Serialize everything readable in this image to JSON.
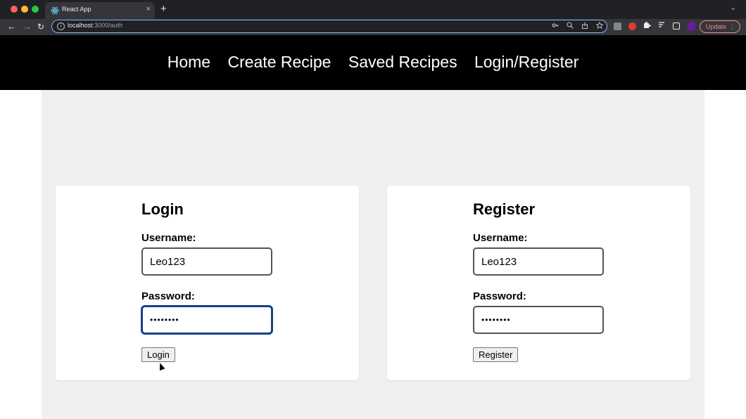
{
  "browser": {
    "tab_title": "React App",
    "tab_close": "×",
    "new_tab": "+",
    "tab_menu": "⌄",
    "url_host": "localhost",
    "url_path": ":3000/auth",
    "update_label": "Update",
    "update_menu": "⋮",
    "back": "←",
    "forward": "→",
    "reload": "↻",
    "info": "i"
  },
  "nav": {
    "links": [
      "Home",
      "Create Recipe",
      "Saved Recipes",
      "Login/Register"
    ]
  },
  "login": {
    "title": "Login",
    "username_label": "Username:",
    "username_value": "Leo123",
    "password_label": "Password:",
    "password_mask": "••••••••",
    "button_label": "Login"
  },
  "register": {
    "title": "Register",
    "username_label": "Username:",
    "username_value": "Leo123",
    "password_label": "Password:",
    "password_mask": "••••••••",
    "button_label": "Register"
  },
  "icons": {
    "favicon": "react-icon",
    "key": "key-icon",
    "zoom": "zoom-icon",
    "share": "share-icon",
    "star": "star-icon"
  },
  "colors": {
    "nav_bg": "#000000",
    "page_bg": "#f0f0f0",
    "focus_ring": "#1a3e8c"
  }
}
